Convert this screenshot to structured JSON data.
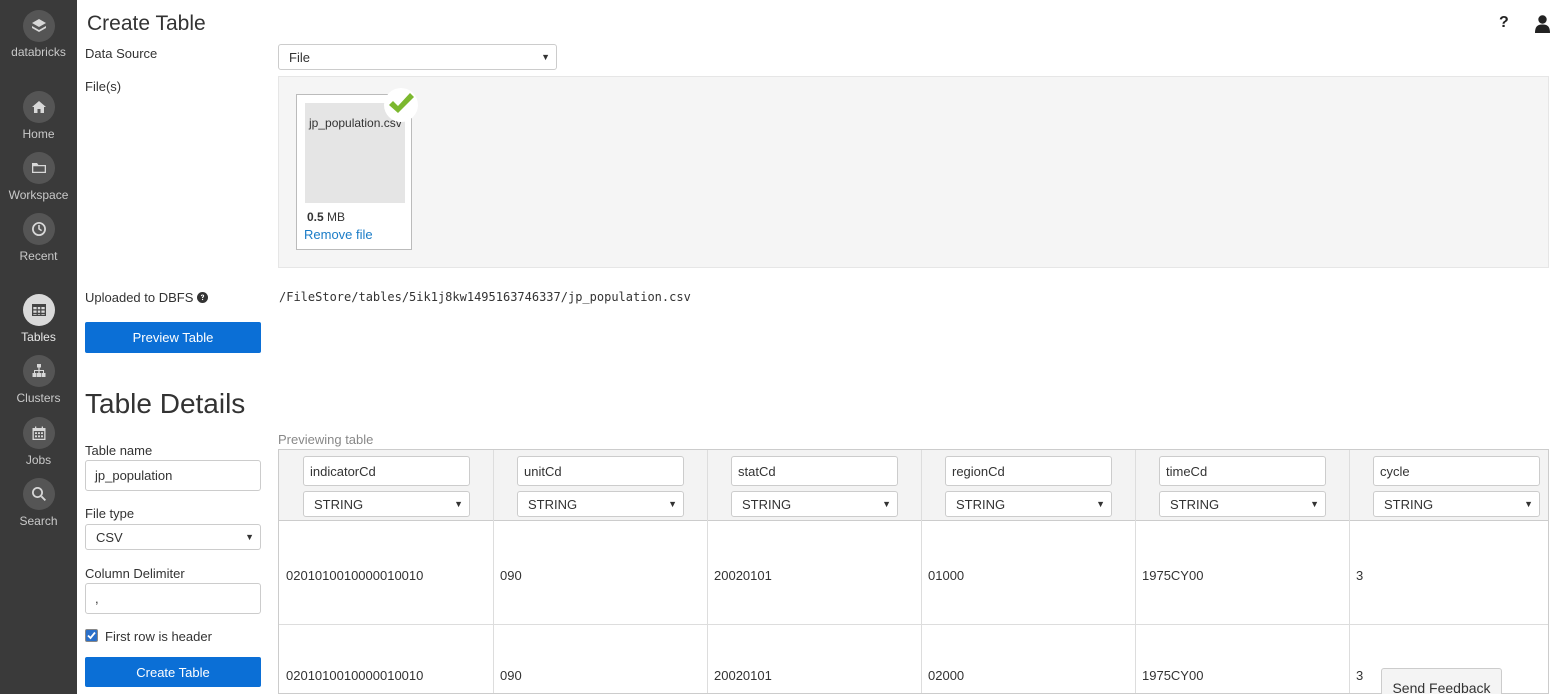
{
  "sidebar": {
    "logo_label": "databricks",
    "items": [
      {
        "label": "Home",
        "icon": "home-icon"
      },
      {
        "label": "Workspace",
        "icon": "folder-icon"
      },
      {
        "label": "Recent",
        "icon": "clock-icon"
      },
      {
        "label": "Tables",
        "icon": "table-icon",
        "active": true
      },
      {
        "label": "Clusters",
        "icon": "clusters-icon"
      },
      {
        "label": "Jobs",
        "icon": "calendar-icon"
      },
      {
        "label": "Search",
        "icon": "search-icon"
      }
    ]
  },
  "header": {
    "title": "Create Table",
    "help_label": "?"
  },
  "form": {
    "data_source_label": "Data Source",
    "data_source_value": "File",
    "files_label": "File(s)",
    "file": {
      "name": "jp_population.csv",
      "size_number": "0.5",
      "size_unit": "MB",
      "remove_label": "Remove file"
    },
    "uploaded_label": "Uploaded to DBFS",
    "uploaded_path": "/FileStore/tables/5ik1j8kw1495163746337/jp_population.csv",
    "preview_button": "Preview Table"
  },
  "details": {
    "title": "Table Details",
    "table_name_label": "Table name",
    "table_name_value": "jp_population",
    "file_type_label": "File type",
    "file_type_value": "CSV",
    "delimiter_label": "Column Delimiter",
    "delimiter_value": ",",
    "first_row_header_label": "First row is header",
    "first_row_header_checked": true,
    "create_button": "Create Table"
  },
  "preview": {
    "label": "Previewing table",
    "columns": [
      {
        "name": "indicatorCd",
        "type": "STRING"
      },
      {
        "name": "unitCd",
        "type": "STRING"
      },
      {
        "name": "statCd",
        "type": "STRING"
      },
      {
        "name": "regionCd",
        "type": "STRING"
      },
      {
        "name": "timeCd",
        "type": "STRING"
      },
      {
        "name": "cycle",
        "type": "STRING"
      }
    ],
    "rows": [
      [
        "0201010010000010010",
        "090",
        "20020101",
        "01000",
        "1975CY00",
        "3"
      ],
      [
        "0201010010000010010",
        "090",
        "20020101",
        "02000",
        "1975CY00",
        "3"
      ]
    ]
  },
  "feedback_label": "Send Feedback",
  "colors": {
    "sidebar_bg": "#3a3a3a",
    "primary_button": "#0b6fd6",
    "link": "#1a7cc7",
    "check_green": "#7cb82f"
  }
}
